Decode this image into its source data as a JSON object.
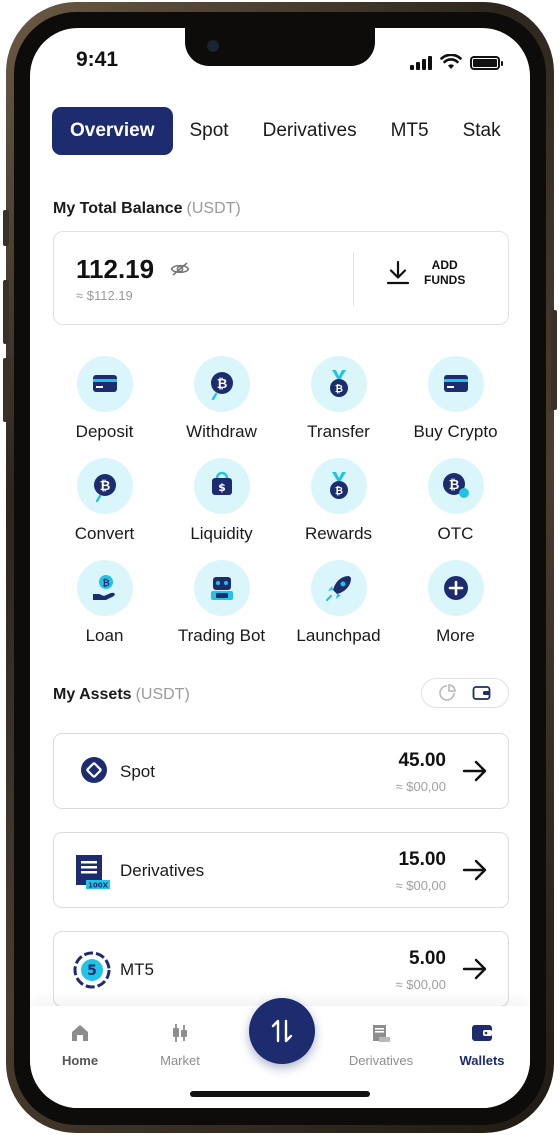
{
  "status_bar": {
    "time": "9:41"
  },
  "tabs": [
    {
      "label": "Overview",
      "active": true
    },
    {
      "label": "Spot"
    },
    {
      "label": "Derivatives"
    },
    {
      "label": "MT5"
    },
    {
      "label": "Stak"
    }
  ],
  "balance": {
    "title": "My Total Balance",
    "unit": "(USDT)",
    "amount": "112.19",
    "approx": "≈ $112.19",
    "add_funds_line1": "ADD",
    "add_funds_line2": "FUNDS"
  },
  "actions": [
    {
      "label": "Deposit",
      "icon": "card-icon"
    },
    {
      "label": "Withdraw",
      "icon": "bitcoin-out-icon"
    },
    {
      "label": "Transfer",
      "icon": "medal-icon"
    },
    {
      "label": "Buy Crypto",
      "icon": "card-icon"
    },
    {
      "label": "Convert",
      "icon": "bitcoin-convert-icon"
    },
    {
      "label": "Liquidity",
      "icon": "bag-dollar-icon"
    },
    {
      "label": "Rewards",
      "icon": "medal-icon"
    },
    {
      "label": "OTC",
      "icon": "bitcoin-otc-icon"
    },
    {
      "label": "Loan",
      "icon": "hand-coin-icon"
    },
    {
      "label": "Trading Bot",
      "icon": "robot-icon"
    },
    {
      "label": "Launchpad",
      "icon": "rocket-icon"
    },
    {
      "label": "More",
      "icon": "plus-icon"
    }
  ],
  "assets": {
    "title": "My Assets",
    "unit": "(USDT)",
    "items": [
      {
        "name": "Spot",
        "value": "45.00",
        "approx": "≈ $00,00"
      },
      {
        "name": "Derivatives",
        "value": "15.00",
        "approx": "≈ $00,00",
        "logo_text": "100X"
      },
      {
        "name": "MT5",
        "value": "5.00",
        "approx": "≈ $00,00",
        "logo_text": "5"
      }
    ]
  },
  "bottom_nav": [
    {
      "label": "Home"
    },
    {
      "label": "Market"
    },
    {
      "label": "Derivatives"
    },
    {
      "label": "Wallets",
      "active": true
    }
  ],
  "colors": {
    "primary": "#1d2c6e",
    "icon_bg": "#dbf6fb",
    "accent_cyan": "#22c3e6"
  }
}
